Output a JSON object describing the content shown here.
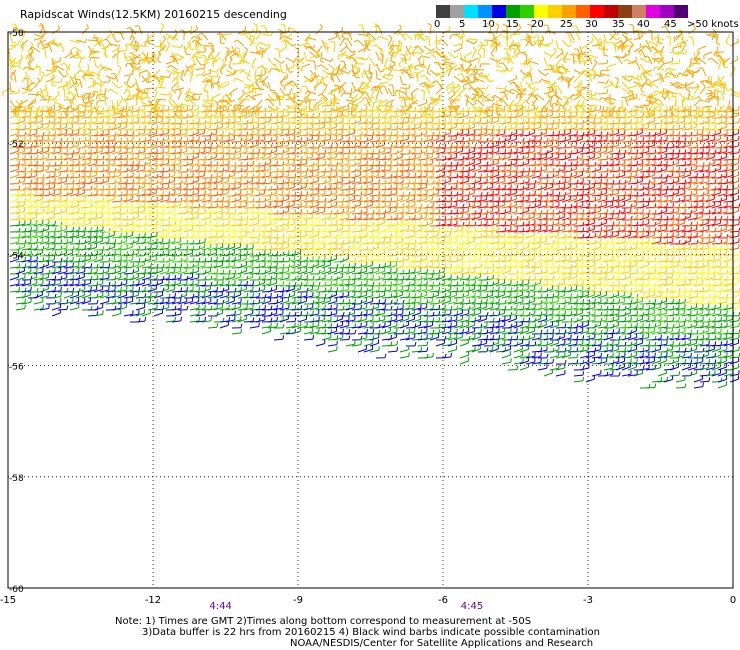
{
  "title": "Rapidscat Winds(12.5KM) 20160215 descending",
  "colorbar": {
    "labels": [
      "0",
      "5",
      "10",
      "15",
      "20",
      "25",
      "30",
      "35",
      "40",
      "45",
      ">50 knots"
    ],
    "colors": [
      "#404040",
      "#a0a0a0",
      "#00e0ff",
      "#0090ff",
      "#0000e0",
      "#00a000",
      "#30d000",
      "#ffff00",
      "#ffd000",
      "#ffa000",
      "#ff6000",
      "#ff0000",
      "#c00000",
      "#8b4010",
      "#d08060",
      "#e000e0",
      "#a000c0",
      "#500070"
    ]
  },
  "map": {
    "lon_range": [
      -15,
      0
    ],
    "lat_range": [
      -60,
      -50
    ],
    "lat_ticks": [
      "-50",
      "-52",
      "-54",
      "-56",
      "-58",
      "-60"
    ],
    "lon_ticks": [
      "-15",
      "-12",
      "-9",
      "-6",
      "-3",
      "0"
    ],
    "time_labels": [
      {
        "text": "4:44",
        "lon": -10.6
      },
      {
        "text": "4:45",
        "lon": -5.4
      }
    ],
    "time_color": "#660099"
  },
  "notes": {
    "line1": "Note: 1) Times are GMT 2)Times along bottom correspond to measurement at -50S",
    "line2": "3)Data buffer is 22 hrs from 20160215 4) Black wind barbs indicate possible contamination",
    "line3": "NOAA/NESDIS/Center for Satellite Applications and Research"
  }
}
